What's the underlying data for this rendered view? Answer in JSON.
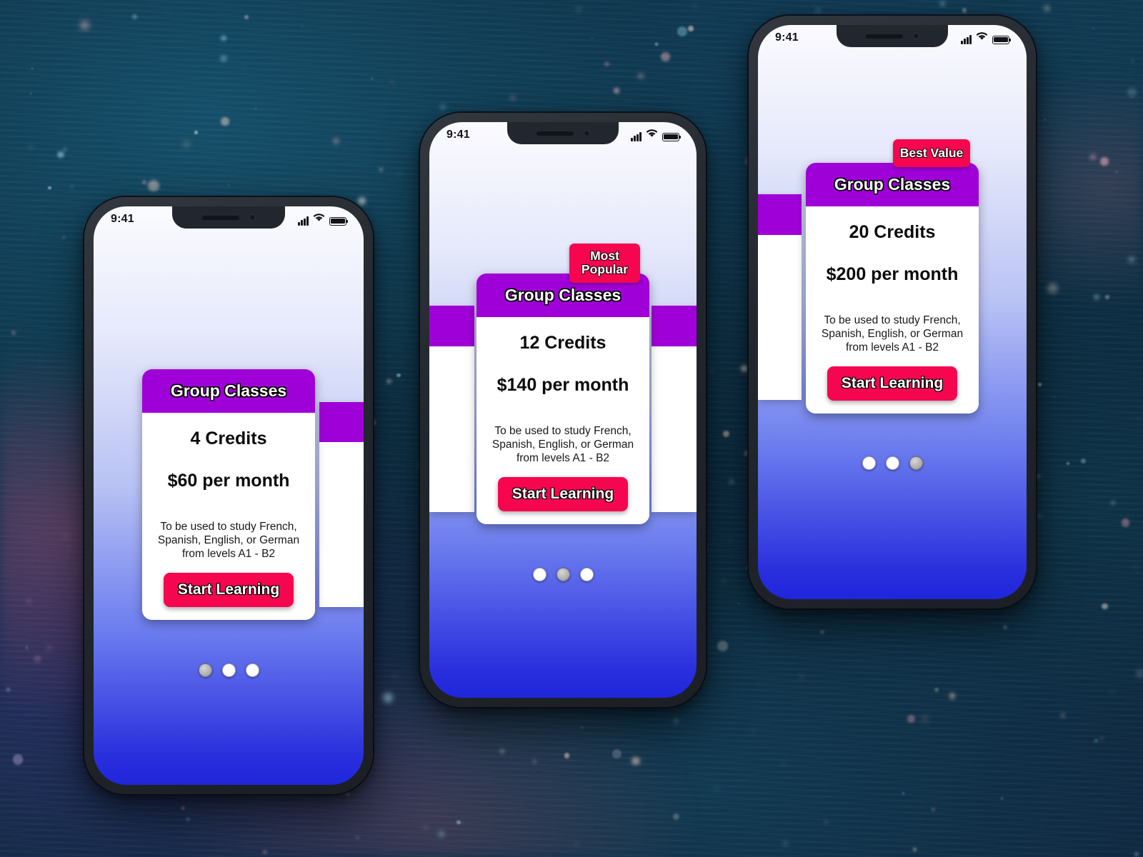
{
  "colors": {
    "card_header_purple": "#A000D8",
    "cta_pink": "#F5064F",
    "screen_gradient_top": "#FBFBFE",
    "screen_gradient_bottom": "#1F26DB",
    "phone_bezel": "#23272E",
    "dot_inactive": "#FFFFFF",
    "dot_active": "#A9A9A9"
  },
  "status_bar": {
    "time": "9:41",
    "signal_icon": "cellular-signal-icon",
    "wifi_icon": "wifi-icon",
    "battery_icon": "battery-full-icon"
  },
  "plan_common": {
    "header_title": "Group Classes",
    "description": "To be used to study French, Spanish, English, or German from levels A1 - B2",
    "cta_label": "Start Learning"
  },
  "phones": [
    {
      "id": "phone-1",
      "plan": {
        "header_title": "Group Classes",
        "credits": "4 Credits",
        "price": "$60 per month",
        "description": "To be used to study French, Spanish, English, or German from levels A1 - B2",
        "cta_label": "Start Learning"
      },
      "badge": null,
      "pagination": {
        "total": 3,
        "active_index": 0
      }
    },
    {
      "id": "phone-2",
      "plan": {
        "header_title": "Group Classes",
        "credits": "12 Credits",
        "price": "$140 per month",
        "description": "To be used to study French, Spanish, English, or German from levels A1 - B2",
        "cta_label": "Start Learning"
      },
      "badge": "Most\nPopular",
      "pagination": {
        "total": 3,
        "active_index": 1
      }
    },
    {
      "id": "phone-3",
      "plan": {
        "header_title": "Group Classes",
        "credits": "20 Credits",
        "price": "$200 per month",
        "description": "To be used to study French, Spanish, English, or German from levels A1 - B2",
        "cta_label": "Start Learning"
      },
      "badge": "Best Value",
      "pagination": {
        "total": 3,
        "active_index": 2
      }
    }
  ]
}
